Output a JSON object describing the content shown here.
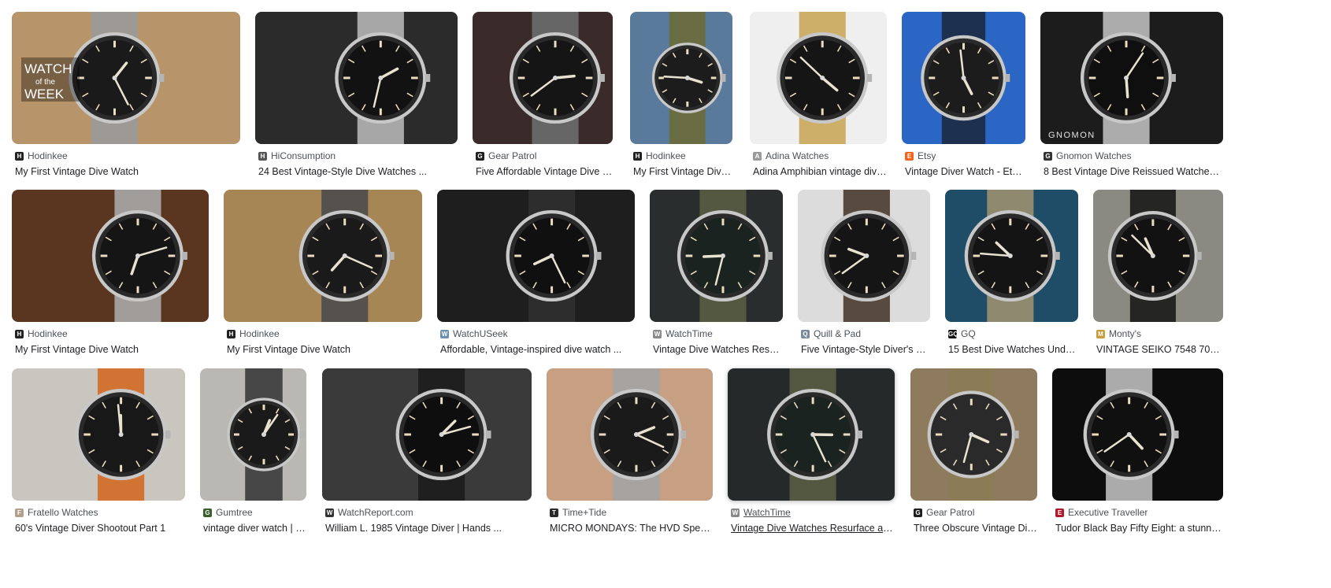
{
  "results": [
    {
      "source": "Hodinkee",
      "title": "My First Vintage Dive Watch",
      "favicon": "H",
      "favicon_color": "#222222",
      "bg": "#b8946a",
      "dial": "#1a1a1a",
      "strap": "#9a9a9a",
      "overlay_text": [
        "WATCH",
        "of the",
        "WEEK"
      ]
    },
    {
      "source": "HiConsumption",
      "title": "24 Best Vintage-Style Dive Watches ...",
      "favicon": "H",
      "favicon_color": "#555555",
      "bg": "#2b2b2b",
      "dial": "#121212",
      "strap": "#b5b5b5"
    },
    {
      "source": "Gear Patrol",
      "title": "Five Affordable Vintage Dive W...",
      "favicon": "G",
      "favicon_color": "#1f1f1f",
      "bg": "#3a2a2a",
      "dial": "#151515",
      "strap": "#6d6d6d"
    },
    {
      "source": "Hodinkee",
      "title": "My First Vintage Dive ...",
      "favicon": "H",
      "favicon_color": "#222222",
      "bg": "#5a7a9c",
      "dial": "#1c1c1c",
      "strap": "#6b6b3a"
    },
    {
      "source": "Adina Watches",
      "title": "Adina Amphibian vintage dive ...",
      "favicon": "A",
      "favicon_color": "#9a9a9a",
      "bg": "#efefef",
      "dial": "#151515",
      "strap": "#c9a75a"
    },
    {
      "source": "Etsy",
      "title": "Vintage Diver Watch - Etsy ...",
      "favicon": "E",
      "favicon_color": "#f1641e",
      "bg": "#2c66c4",
      "dial": "#1c1c1c",
      "strap": "#1d2a44"
    },
    {
      "source": "Gnomon Watches",
      "title": "8 Best Vintage Dive Reissued Watches ...",
      "favicon": "G",
      "favicon_color": "#333333",
      "bg": "#1c1c1c",
      "dial": "#0f0f0f",
      "strap": "#bdbdbd",
      "overlay_text": [
        "GNOMON"
      ]
    },
    {
      "source": "Hodinkee",
      "title": "My First Vintage Dive Watch",
      "favicon": "H",
      "favicon_color": "#222222",
      "bg": "#5a3520",
      "dial": "#151515",
      "strap": "#a8a8a8"
    },
    {
      "source": "Hodinkee",
      "title": "My First Vintage Dive Watch",
      "favicon": "H",
      "favicon_color": "#222222",
      "bg": "#a78656",
      "dial": "#1a1a1a",
      "strap": "#4d4d4d"
    },
    {
      "source": "WatchUSeek",
      "title": "Affordable, Vintage-inspired dive watch ...",
      "favicon": "W",
      "favicon_color": "#6a8fb3",
      "bg": "#1e1e1e",
      "dial": "#101010",
      "strap": "#2f2f2f"
    },
    {
      "source": "WatchTime",
      "title": "Vintage Dive Watches Resurf...",
      "favicon": "W",
      "favicon_color": "#8a8a8a",
      "bg": "#2a2d2d",
      "dial": "#1b2320",
      "strap": "#5a5d44"
    },
    {
      "source": "Quill & Pad",
      "title": "Five Vintage-Style Diver's Wat...",
      "favicon": "Q",
      "favicon_color": "#7a8a9a",
      "bg": "#dcdcdc",
      "dial": "#151515",
      "strap": "#4a3a2e"
    },
    {
      "source": "GQ",
      "title": "15 Best Dive Watches Under ...",
      "favicon": "GQ",
      "favicon_color": "#111111",
      "bg": "#1f4c66",
      "dial": "#141414",
      "strap": "#9b9070"
    },
    {
      "source": "Monty's",
      "title": "VINTAGE SEIKO 7548 7000 ...",
      "favicon": "M",
      "favicon_color": "#c79a3a",
      "bg": "#8a8a82",
      "dial": "#121212",
      "strap": "#1a1a1a"
    },
    {
      "source": "Fratello Watches",
      "title": "60's Vintage Diver Shootout Part 1",
      "favicon": "F",
      "favicon_color": "#b2a08a",
      "bg": "#c9c6c0",
      "dial": "#181818",
      "strap": "#d26a24"
    },
    {
      "source": "Gumtree",
      "title": "vintage diver watch | W...",
      "favicon": "G",
      "favicon_color": "#3c5e2c",
      "bg": "#b9b8b2",
      "dial": "#1a1a1a",
      "strap": "#3b3b3b"
    },
    {
      "source": "WatchReport.com",
      "title": "William L. 1985 Vintage Diver | Hands ...",
      "favicon": "W",
      "favicon_color": "#333333",
      "bg": "#3a3a3a",
      "dial": "#0e0e0e",
      "strap": "#1d1d1d"
    },
    {
      "source": "Time+Tide",
      "title": "MICRO MONDAYS: The HVD SpectreD...",
      "favicon": "T",
      "favicon_color": "#2a2a2a",
      "bg": "#c7a083",
      "dial": "#1a1a1a",
      "strap": "#a3a3a3"
    },
    {
      "source": "WatchTime",
      "title": "Vintage Dive Watches Resurface as S...",
      "favicon": "W",
      "favicon_color": "#8a8a8a",
      "bg": "#262929",
      "dial": "#1b2320",
      "strap": "#5a5d44"
    },
    {
      "source": "Gear Patrol",
      "title": "Three Obscure Vintage Dive ...",
      "favicon": "G",
      "favicon_color": "#1f1f1f",
      "bg": "#8e7a5c",
      "dial": "#2a2a2a",
      "strap": "#8b7b55"
    },
    {
      "source": "Executive Traveller",
      "title": "Tudor Black Bay Fifty Eight: a stunning ...",
      "favicon": "E",
      "favicon_color": "#b0192e",
      "bg": "#0d0d0d",
      "dial": "#101010",
      "strap": "#bdbdbd"
    }
  ]
}
